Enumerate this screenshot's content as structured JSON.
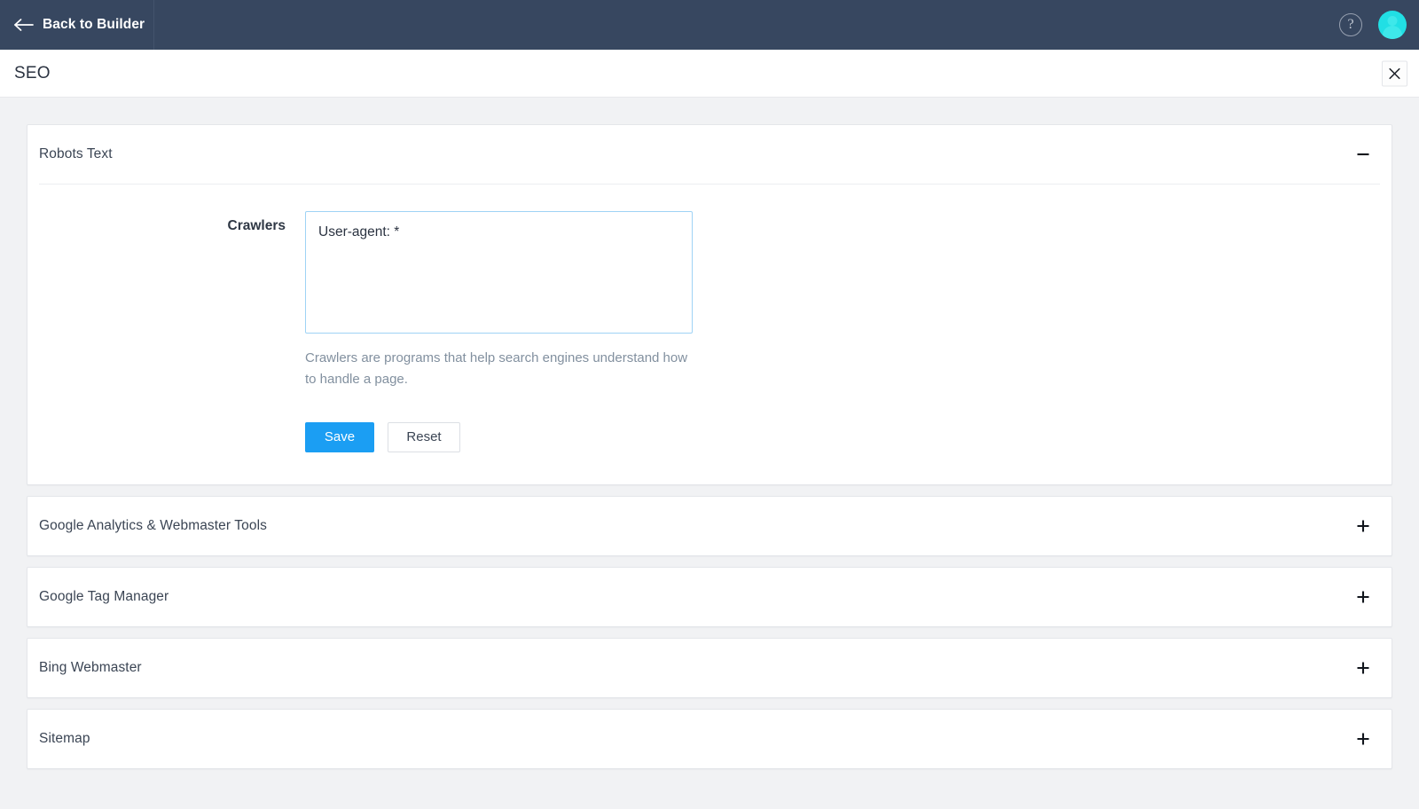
{
  "topbar": {
    "back_label": "Back to Builder",
    "back_arrow_icon": "arrow-left-icon",
    "help_icon": "help-circle-icon",
    "help_glyph": "?",
    "avatar_icon": "user-avatar-icon",
    "background_color": "#374760"
  },
  "titlebar": {
    "title": "SEO",
    "close_icon": "close-icon"
  },
  "colors": {
    "accent": "#1b9ef3",
    "page_background": "#f1f2f4",
    "panel_border": "#e4e6ea",
    "focus_border": "#9fd3f5",
    "avatar": "#21dfe4"
  },
  "panels": [
    {
      "title": "Robots Text",
      "expanded": true,
      "toggle_icon": "minus-icon",
      "field": {
        "label": "Crawlers",
        "value": "User-agent: *",
        "placeholder": "",
        "help": "Crawlers are programs that help search engines understand how to handle a page."
      },
      "buttons": {
        "save_label": "Save",
        "reset_label": "Reset"
      }
    },
    {
      "title": "Google Analytics & Webmaster Tools",
      "expanded": false,
      "toggle_icon": "plus-icon"
    },
    {
      "title": "Google Tag Manager",
      "expanded": false,
      "toggle_icon": "plus-icon"
    },
    {
      "title": "Bing Webmaster",
      "expanded": false,
      "toggle_icon": "plus-icon"
    },
    {
      "title": "Sitemap",
      "expanded": false,
      "toggle_icon": "plus-icon"
    }
  ]
}
